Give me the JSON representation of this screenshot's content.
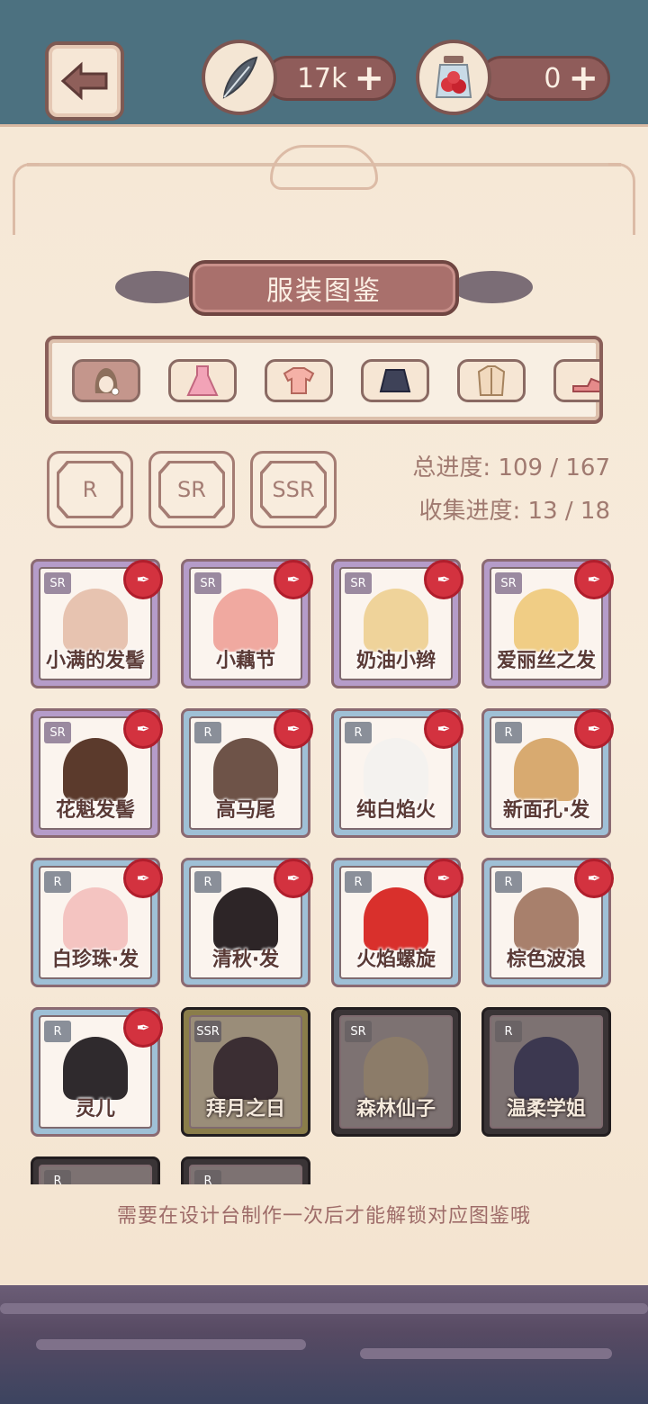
{
  "header": {
    "feather_currency": "17k",
    "potion_currency": "0",
    "plus_symbol": "+",
    "icons": [
      "back-arrow-icon",
      "feather-icon",
      "berry-jar-icon"
    ]
  },
  "panel": {
    "title": "服装图鉴",
    "categories": [
      {
        "name": "hair",
        "icon": "hair-icon"
      },
      {
        "name": "dress",
        "icon": "dress-icon"
      },
      {
        "name": "top",
        "icon": "top-icon"
      },
      {
        "name": "skirt",
        "icon": "skirt-icon"
      },
      {
        "name": "coat",
        "icon": "coat-icon"
      },
      {
        "name": "shoes",
        "icon": "shoes-icon"
      }
    ],
    "rarity_filters": [
      "R",
      "SR",
      "SSR"
    ],
    "total_progress_label": "总进度: 109 / 167",
    "collect_progress_label": "收集进度: 13 / 18",
    "items": [
      {
        "name": "小满的发髻",
        "rarity": "SR",
        "hair_color": "#e7c3b0",
        "locked": false
      },
      {
        "name": "小藕节",
        "rarity": "SR",
        "hair_color": "#f0a9a0",
        "locked": false
      },
      {
        "name": "奶油小辫",
        "rarity": "SR",
        "hair_color": "#efd39a",
        "locked": false
      },
      {
        "name": "爱丽丝之发",
        "rarity": "SR",
        "hair_color": "#f0cd85",
        "locked": false
      },
      {
        "name": "花魁发髻",
        "rarity": "SR",
        "hair_color": "#5b3a2c",
        "locked": false
      },
      {
        "name": "高马尾",
        "rarity": "R",
        "hair_color": "#6e5348",
        "locked": false
      },
      {
        "name": "纯白焰火",
        "rarity": "R",
        "hair_color": "#f4f2ef",
        "locked": false
      },
      {
        "name": "新面孔·发",
        "rarity": "R",
        "hair_color": "#d8aa70",
        "locked": false
      },
      {
        "name": "白珍珠·发",
        "rarity": "R",
        "hair_color": "#f4c4c1",
        "locked": false
      },
      {
        "name": "清秋·发",
        "rarity": "R",
        "hair_color": "#2d2527",
        "locked": false
      },
      {
        "name": "火焰螺旋",
        "rarity": "R",
        "hair_color": "#d9302c",
        "locked": false
      },
      {
        "name": "棕色波浪",
        "rarity": "R",
        "hair_color": "#a8806c",
        "locked": false
      },
      {
        "name": "灵儿",
        "rarity": "R",
        "hair_color": "#2f2a2d",
        "locked": false
      },
      {
        "name": "拜月之日",
        "rarity": "SSR",
        "hair_color": "#3b2e33",
        "locked": true
      },
      {
        "name": "森林仙子",
        "rarity": "SR",
        "hair_color": "#8c7c69",
        "locked": true
      },
      {
        "name": "温柔学姐",
        "rarity": "R",
        "hair_color": "#3c3850",
        "locked": true
      },
      {
        "name": "",
        "rarity": "R",
        "hair_color": "#555",
        "locked": true
      },
      {
        "name": "",
        "rarity": "R",
        "hair_color": "#555",
        "locked": true
      }
    ],
    "footer_note": "需要在设计台制作一次后才能解锁对应图鉴哦"
  },
  "colors": {
    "background_teal": "#4d7280",
    "panel_cream": "#f6e8d6",
    "banner_rose": "#a9706c",
    "seal_red": "#d3323f",
    "sr_frame": "#b59cc9",
    "r_frame": "#9fc0d6"
  }
}
